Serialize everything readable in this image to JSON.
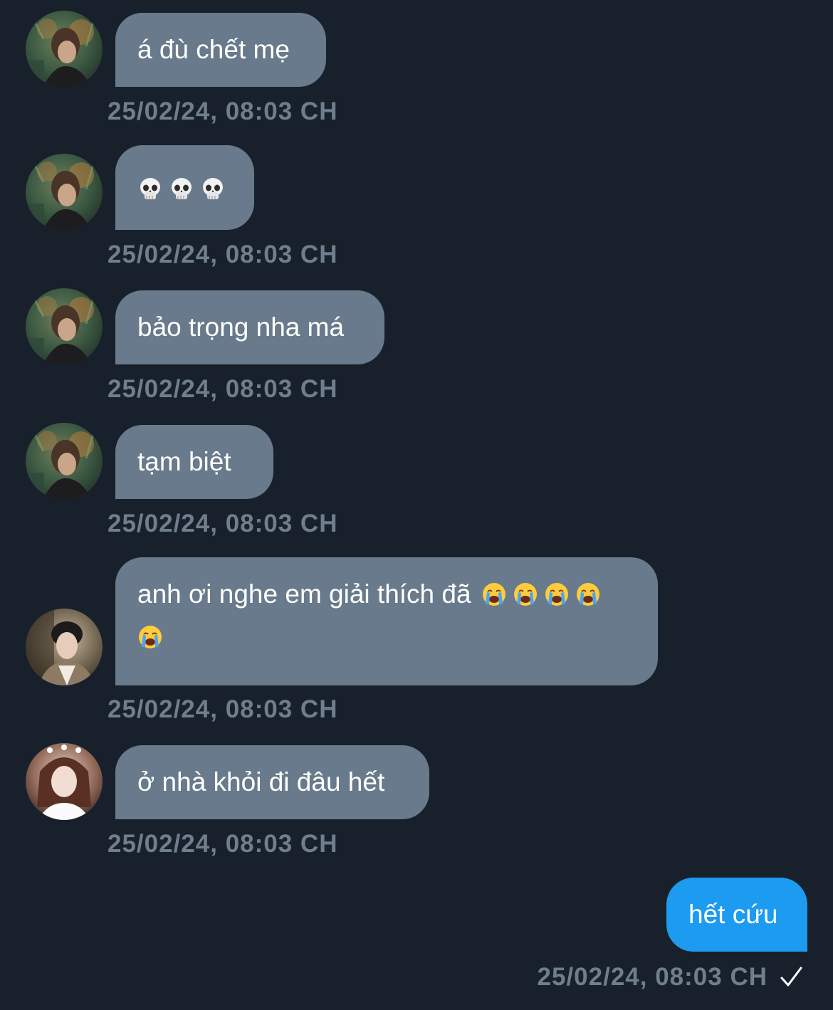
{
  "messages": [
    {
      "text": "á đù chết mẹ",
      "time": "25/02/24, 08:03 CH",
      "sender": "avatar-a"
    },
    {
      "emojis": [
        "skull",
        "skull",
        "skull"
      ],
      "time": "25/02/24, 08:03 CH",
      "sender": "avatar-a"
    },
    {
      "text": "bảo trọng nha má",
      "time": "25/02/24, 08:03 CH",
      "sender": "avatar-a"
    },
    {
      "text": "tạm biệt",
      "time": "25/02/24, 08:03 CH",
      "sender": "avatar-a"
    },
    {
      "text": "anh ơi nghe em giải thích đã",
      "emojis": [
        "loudly-crying-face",
        "loudly-crying-face",
        "loudly-crying-face",
        "loudly-crying-face",
        "loudly-crying-face"
      ],
      "time": "25/02/24, 08:03 CH",
      "sender": "avatar-b"
    },
    {
      "text": "ở nhà khỏi đi đâu hết",
      "time": "25/02/24, 08:03 CH",
      "sender": "avatar-c"
    },
    {
      "text": "hết cứu",
      "time": "25/02/24, 08:03 CH",
      "sender": "self",
      "status_icon": "check-icon"
    }
  ],
  "colors": {
    "background": "#18202b",
    "incoming_bubble": "#687a8b",
    "outgoing_bubble": "#1d9bf0",
    "timestamp": "#6f7e8d",
    "text": "#ffffff"
  }
}
